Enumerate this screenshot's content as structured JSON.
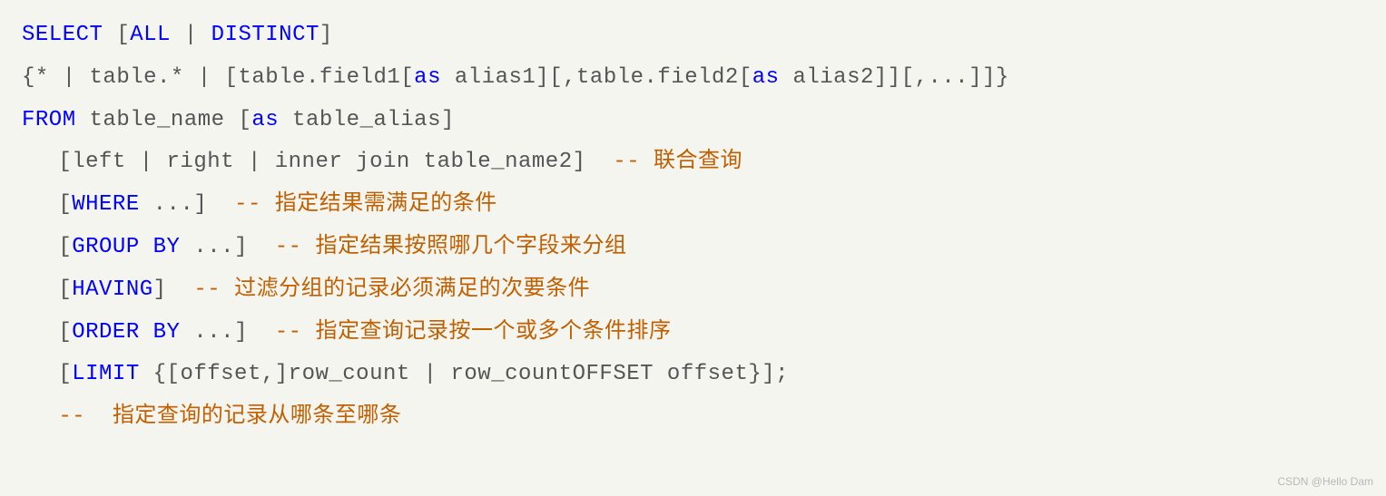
{
  "lines": {
    "l1": {
      "kw1": "SELECT",
      "t1": " [",
      "kw2": "ALL",
      "t2": " | ",
      "kw3": "DISTINCT",
      "t3": "]"
    },
    "l2": {
      "t1": "{* | table.* | [table.field1[",
      "kw1": "as",
      "t2": " alias1][,table.field2[",
      "kw2": "as",
      "t3": " alias2]][,...]]}"
    },
    "l3": {
      "kw1": "FROM",
      "t1": " table_name [",
      "kw2": "as",
      "t2": " table_alias]"
    },
    "l4": {
      "t1": "[left | right | inner join table_name2]  ",
      "c1": "-- 联合查询"
    },
    "l5": {
      "t1": "[",
      "kw1": "WHERE",
      "t2": " ...]  ",
      "c1": "-- 指定结果需满足的条件"
    },
    "l6": {
      "t1": "[",
      "kw1": "GROUP",
      "t2": " ",
      "kw2": "BY",
      "t3": " ...]  ",
      "c1": "-- 指定结果按照哪几个字段来分组"
    },
    "l7": {
      "t1": "[",
      "kw1": "HAVING",
      "t2": "]  ",
      "c1": "-- 过滤分组的记录必须满足的次要条件"
    },
    "l8": {
      "t1": "[",
      "kw1": "ORDER",
      "t2": " ",
      "kw2": "BY",
      "t3": " ...]  ",
      "c1": "-- 指定查询记录按一个或多个条件排序"
    },
    "l9": {
      "t1": "[",
      "kw1": "LIMIT",
      "t2": " {[offset,]row_count | row_countOFFSET offset}];"
    },
    "l10": {
      "c1": "--  指定查询的记录从哪条至哪条"
    }
  },
  "watermark": "CSDN @Hello Dam"
}
